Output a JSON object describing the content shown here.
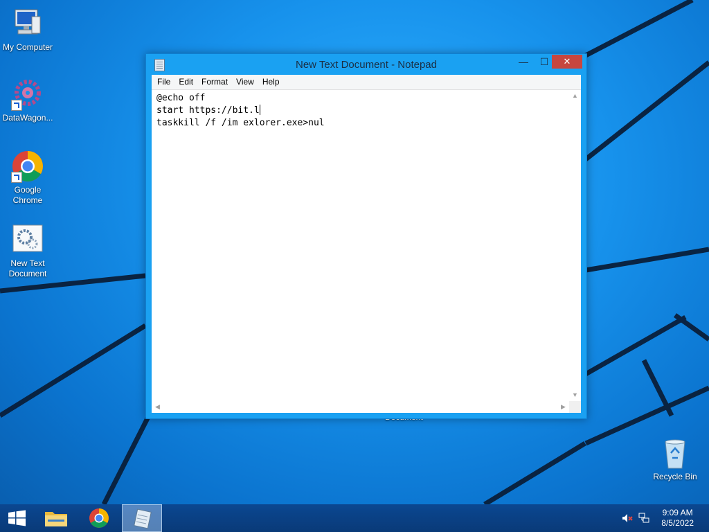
{
  "desktop": {
    "icons": [
      {
        "label": "My Computer",
        "icon": "computer-icon"
      },
      {
        "label": "DataWagon...",
        "icon": "gear-icon"
      },
      {
        "label": "Google Chrome",
        "icon": "chrome-icon"
      },
      {
        "label": "New Text Document",
        "icon": "settings-document-icon"
      },
      {
        "label": "Recycle Bin",
        "icon": "recycle-bin-icon"
      }
    ],
    "behind_window_label": "Document"
  },
  "notepad": {
    "title": "New Text Document - Notepad",
    "window_controls": {
      "minimize": "—",
      "maximize": "☐",
      "close": "✕"
    },
    "menu": [
      "File",
      "Edit",
      "Format",
      "View",
      "Help"
    ],
    "lines": [
      "@echo off",
      "start https://bit.l",
      "taskkill /f /im exlorer.exe>nul"
    ]
  },
  "taskbar": {
    "pinned": [
      {
        "name": "File Explorer",
        "icon": "folder-icon"
      },
      {
        "name": "Google Chrome",
        "icon": "chrome-icon"
      },
      {
        "name": "Notepad",
        "icon": "notepad-icon",
        "active": true
      }
    ],
    "tray": {
      "time": "9:09 AM",
      "date": "8/5/2022",
      "icons": [
        "volume-muted-icon",
        "network-icon"
      ]
    }
  }
}
